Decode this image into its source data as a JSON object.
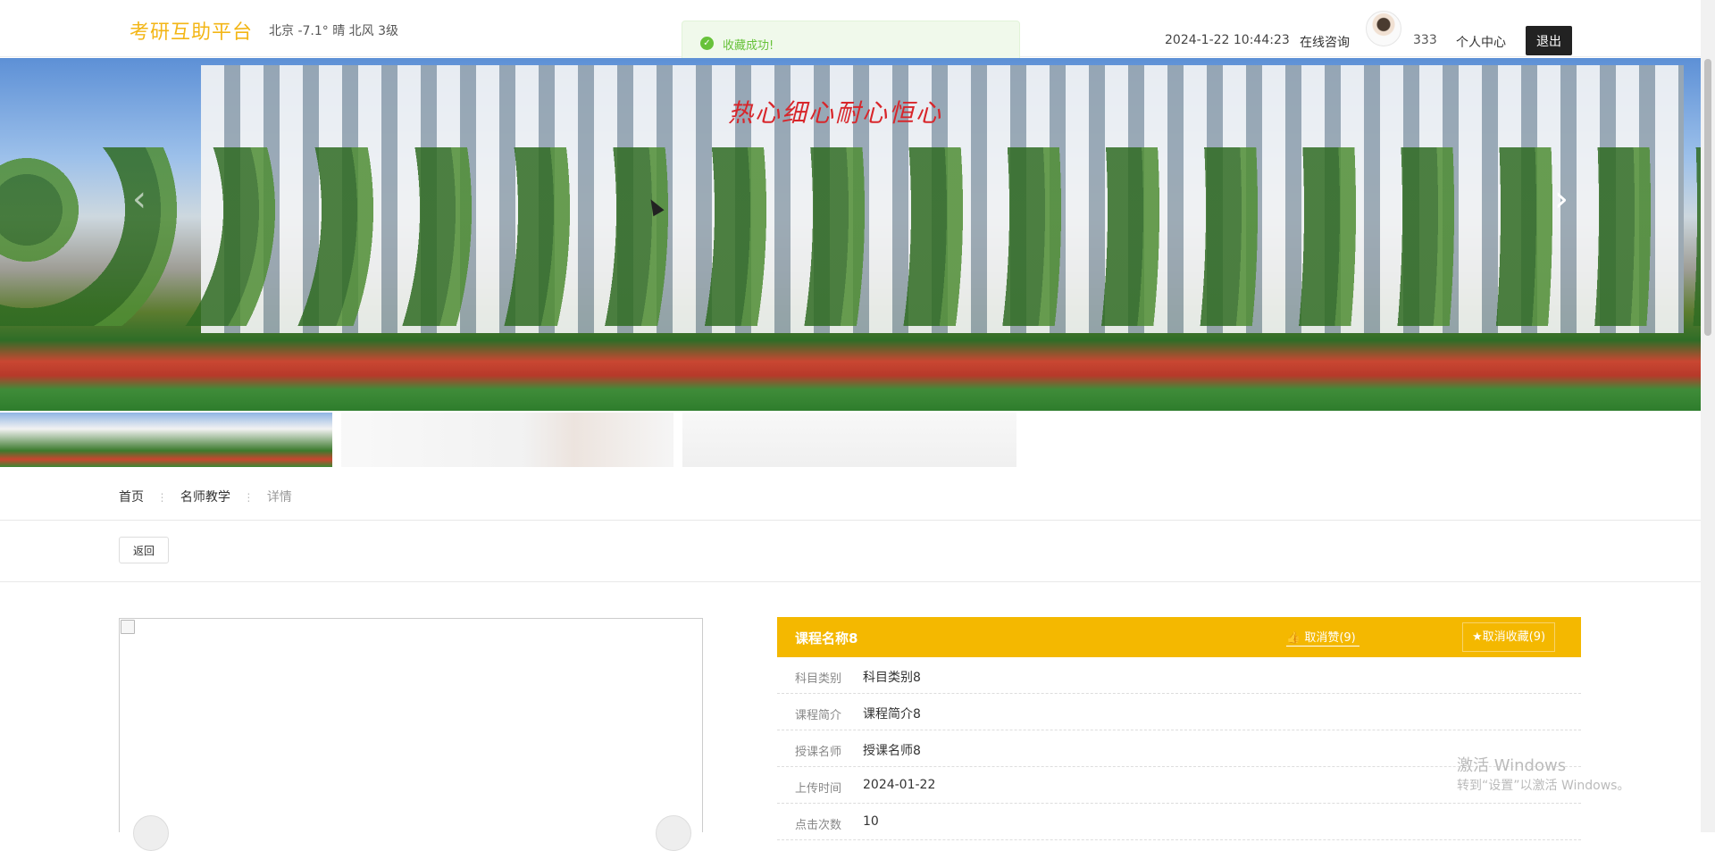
{
  "header": {
    "logo": "考研互助平台",
    "weather": "北京  -7.1°  晴  北风  3级",
    "datetime": "2024-1-22 10:44:23",
    "consult": "在线咨询",
    "username": "333",
    "profile": "个人中心",
    "logout": "退出"
  },
  "toast": {
    "text": "收藏成功!"
  },
  "banner": {
    "slogan": "热心细心耐心恒心",
    "prev_icon": "chevron-left-icon",
    "next_icon": "chevron-right-icon"
  },
  "breadcrumb": [
    "首页",
    "名师教学",
    "详情"
  ],
  "back_label": "返回",
  "course": {
    "title": "课程名称8",
    "unlike": "取消赞(9)",
    "unfavorite": "★取消收藏(9)",
    "rows": [
      {
        "label": "科目类别",
        "value": "科目类别8"
      },
      {
        "label": "课程简介",
        "value": "课程简介8"
      },
      {
        "label": "授课名师",
        "value": "授课名师8"
      },
      {
        "label": "上传时间",
        "value": "2024-01-22"
      },
      {
        "label": "点击次数",
        "value": "10"
      }
    ]
  },
  "watermark": {
    "line1": "激活 Windows",
    "line2": "转到“设置”以激活 Windows。"
  },
  "colors": {
    "brand": "#f3b616",
    "panel_header": "#f4b800",
    "success": "#67c23a"
  }
}
